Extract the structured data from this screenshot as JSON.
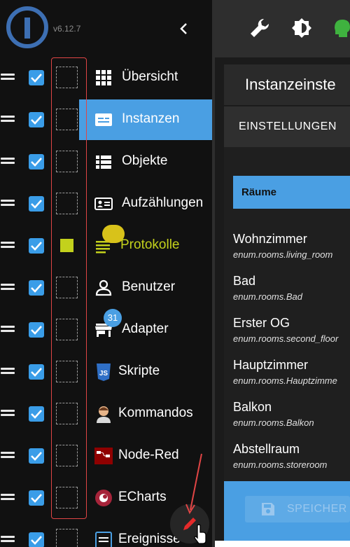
{
  "app": {
    "version": "v6.12.7"
  },
  "colors": {
    "accent": "#4a9fe3",
    "yellow": "#c3d11c",
    "annotation_red": "#e04545"
  },
  "sidebar": {
    "collapse_icon": "chevron-left-icon",
    "items": [
      {
        "label": "Übersicht",
        "icon": "grid-icon"
      },
      {
        "label": "Instanzen",
        "icon": "instances-icon",
        "active": true
      },
      {
        "label": "Objekte",
        "icon": "list-icon"
      },
      {
        "label": "Aufzählungen",
        "icon": "enum-icon"
      },
      {
        "label": "Protokolle",
        "icon": "log-icon",
        "badge": "",
        "highlight": true
      },
      {
        "label": "Benutzer",
        "icon": "user-icon"
      },
      {
        "label": "Adapter",
        "icon": "store-icon",
        "badge": "31"
      },
      {
        "label": "Skripte",
        "icon": "js-icon"
      },
      {
        "label": "Kommandos",
        "icon": "person-icon"
      },
      {
        "label": "Node-Red",
        "icon": "node-red-icon"
      },
      {
        "label": "ECharts",
        "icon": "echarts-icon"
      },
      {
        "label": "Ereignisse",
        "icon": "events-icon"
      }
    ],
    "fab_icon": "pencil-icon"
  },
  "topbar": {
    "icons": [
      "wrench-icon",
      "theme-icon",
      "expert-icon"
    ]
  },
  "main": {
    "title": "Instanzeinste",
    "tab": "EINSTELLUNGEN",
    "section": "Räume",
    "enums": [
      {
        "name": "Wohnzimmer",
        "id": "enum.rooms.living_room"
      },
      {
        "name": "Bad",
        "id": "enum.rooms.Bad"
      },
      {
        "name": "Erster OG",
        "id": "enum.rooms.second_floor"
      },
      {
        "name": "Hauptzimmer",
        "id": "enum.rooms.Hauptzimme"
      },
      {
        "name": "Balkon",
        "id": "enum.rooms.Balkon"
      },
      {
        "name": "Abstellraum",
        "id": "enum.rooms.storeroom"
      }
    ],
    "save_label": "SPEICHER"
  }
}
